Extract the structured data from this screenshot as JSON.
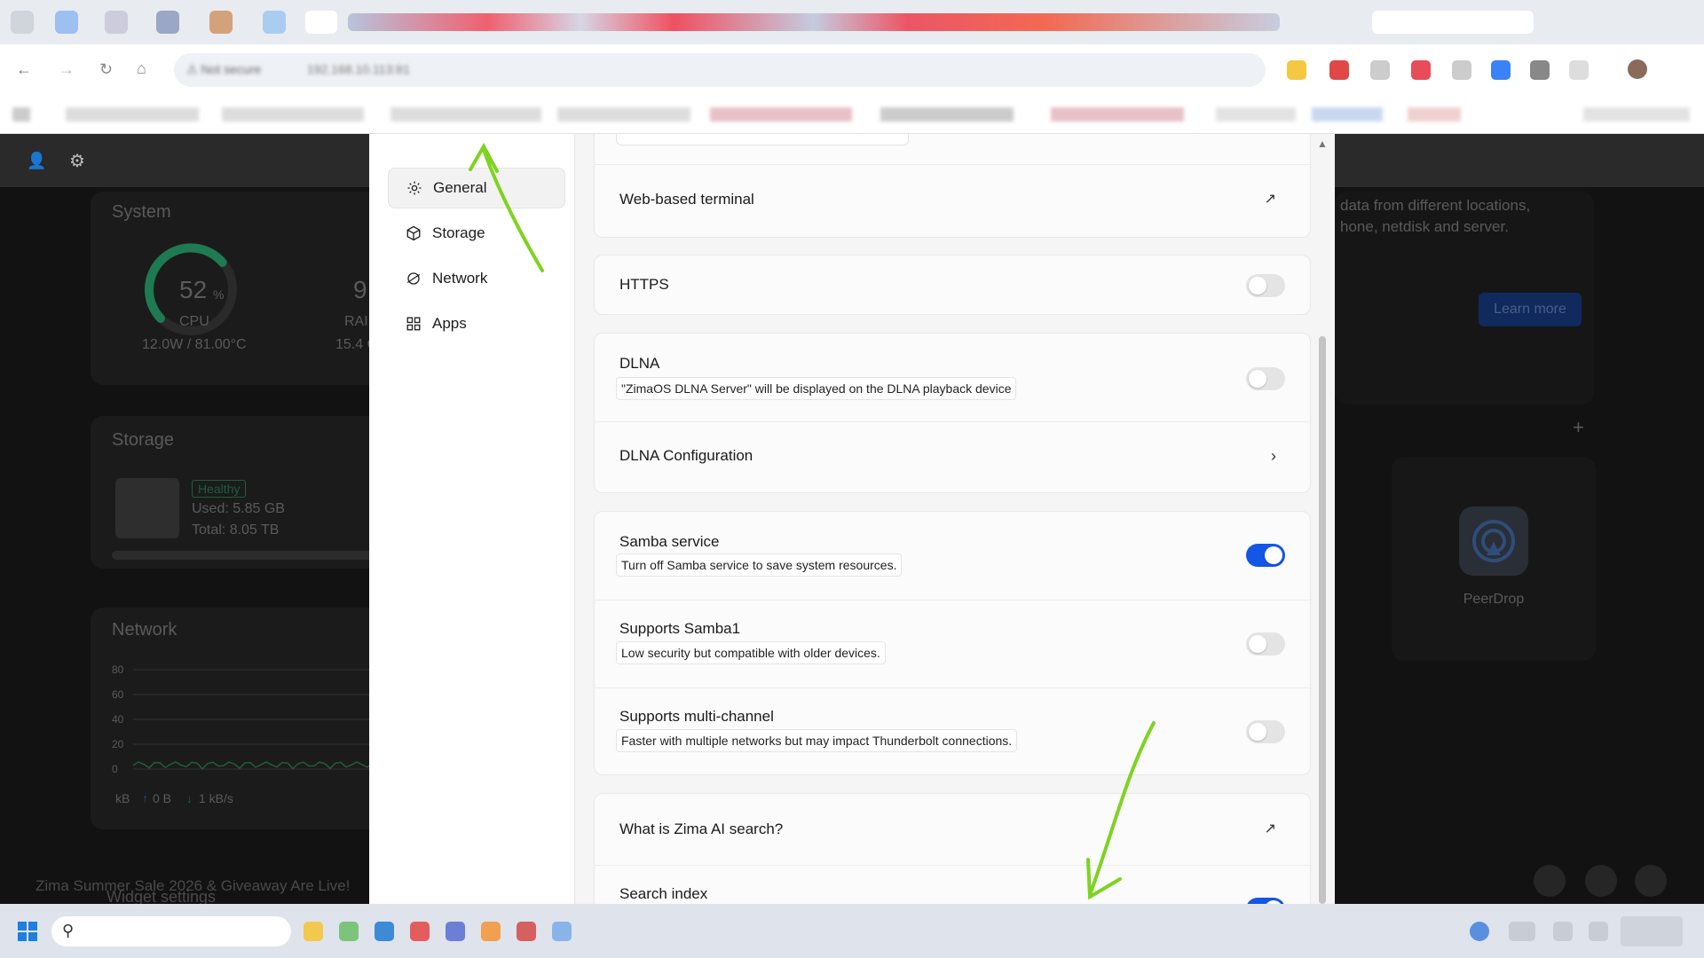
{
  "dashboard": {
    "system": {
      "title": "System",
      "cpu_percent": "52",
      "cpu_unit": "%",
      "cpu_label": "CPU",
      "cpu_detail": "12.0W / 81.00°C",
      "ram_value": "9",
      "ram_label": "RAI",
      "ram_detail": "15.4 G"
    },
    "storage": {
      "title": "Storage",
      "badge": "Healthy",
      "used": "Used: 5.85 GB",
      "total": "Total: 8.05 TB"
    },
    "network": {
      "title": "Network",
      "ticks": [
        "80",
        "60",
        "40",
        "20",
        "0"
      ],
      "footer_unit": "kB",
      "upload": "0 B",
      "download": "1 kB/s"
    },
    "promo": {
      "line1": "data from different locations,",
      "line2": "hone, netdisk and server.",
      "button": "Learn more"
    },
    "app": {
      "name": "PeerDrop"
    },
    "banner": "Zima Summer Sale 2026 & Giveaway Are Live!",
    "widget_settings": "Widget settings"
  },
  "settings_nav": [
    {
      "label": "General",
      "icon": "gear-icon"
    },
    {
      "label": "Storage",
      "icon": "cube-icon"
    },
    {
      "label": "Network",
      "icon": "globe-icon"
    },
    {
      "label": "Apps",
      "icon": "grid-icon"
    }
  ],
  "settings": {
    "web_terminal": "Web-based terminal",
    "https": {
      "title": "HTTPS",
      "enabled": false
    },
    "dlna": {
      "title": "DLNA",
      "desc": "\"ZimaOS DLNA Server\" will be displayed on the DLNA playback device",
      "enabled": false
    },
    "dlna_config": "DLNA Configuration",
    "samba": {
      "title": "Samba service",
      "desc": "Turn off Samba service to save system resources.",
      "enabled": true
    },
    "samba1": {
      "title": "Supports Samba1",
      "desc": "Low security but compatible with older devices.",
      "enabled": false
    },
    "multichannel": {
      "title": "Supports multi-channel",
      "desc": "Faster with multiple networks but may impact Thunderbolt connections.",
      "enabled": false
    },
    "ai_search": "What is Zima AI search?",
    "search_index": {
      "title": "Search index",
      "enabled": true
    }
  },
  "colors": {
    "accent": "#1456e6",
    "annotation": "#7ed321",
    "healthy": "#2ecc71"
  }
}
